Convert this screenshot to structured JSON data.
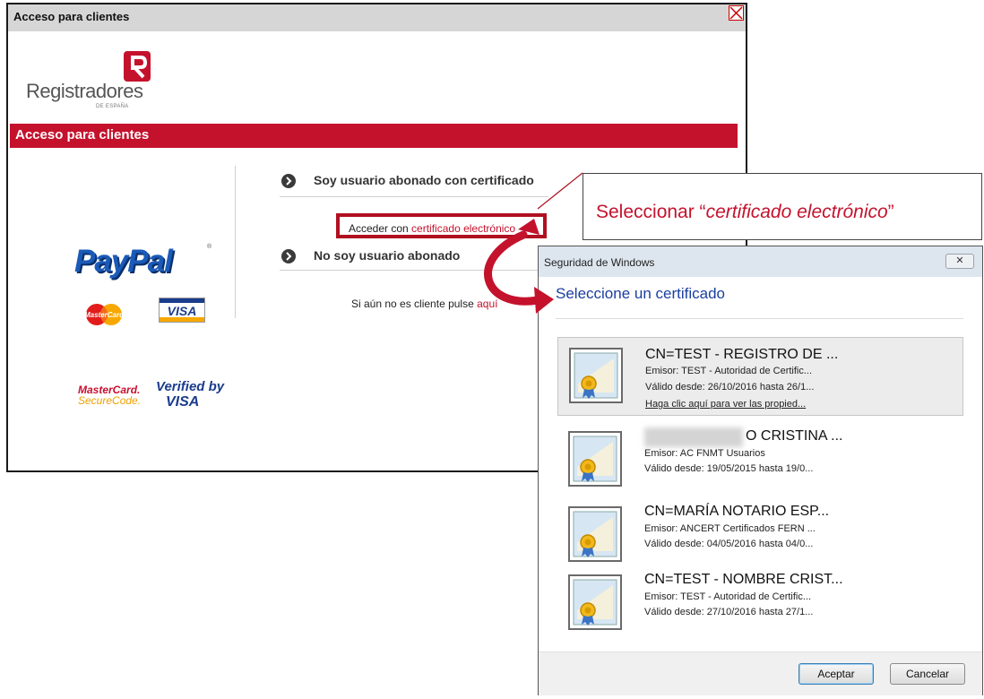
{
  "web_dialog": {
    "title": "Acceso para clientes",
    "brand": {
      "name": "Registradores",
      "sub": "DE ESPAÑA"
    },
    "section_title": "Acceso para clientes",
    "payments": {
      "paypal": "PayPal",
      "visa": "VISA",
      "mastercard_secure_1": "MasterCard.",
      "mastercard_secure_2": "SecureCode.",
      "vbv_1": "Verified by",
      "vbv_2": "VISA"
    },
    "option1": "Soy usuario abonado con certificado",
    "access_prefix": "Acceder con ",
    "access_link": "certificado electrónico",
    "option2": "No soy usuario abonado",
    "signup_prefix": "Si aún no es cliente pulse ",
    "signup_link": "aquí"
  },
  "callout": {
    "prefix": "Seleccionar “",
    "emph": "certificado electrónico",
    "suffix": "”"
  },
  "win_dialog": {
    "title": "Seguridad de Windows",
    "close": "✕",
    "heading": "Seleccione un certificado",
    "certificates": [
      {
        "title": "CN=TEST -  REGISTRO DE ...",
        "issuer": "Emisor: TEST - Autoridad de Certific...",
        "validity": "Válido desde: 26/10/2016 hasta 26/1...",
        "link": "Haga clic aquí para ver las propied..."
      },
      {
        "title": "O CRISTINA ...",
        "issuer": "Emisor: AC FNMT Usuarios",
        "validity": "Válido desde: 19/05/2015 hasta 19/0..."
      },
      {
        "title": "CN=MARÍA NOTARIO ESP...",
        "issuer": "Emisor: ANCERT Certificados FERN ...",
        "validity": "Válido desde: 04/05/2016 hasta 04/0..."
      },
      {
        "title": "CN=TEST - NOMBRE CRIST...",
        "issuer": "Emisor: TEST - Autoridad de Certific...",
        "validity": "Válido desde: 27/10/2016 hasta 27/1..."
      }
    ],
    "accept": "Aceptar",
    "cancel": "Cancelar"
  },
  "colors": {
    "brand_red": "#c4122d",
    "link_blue": "#1a3fa0"
  }
}
